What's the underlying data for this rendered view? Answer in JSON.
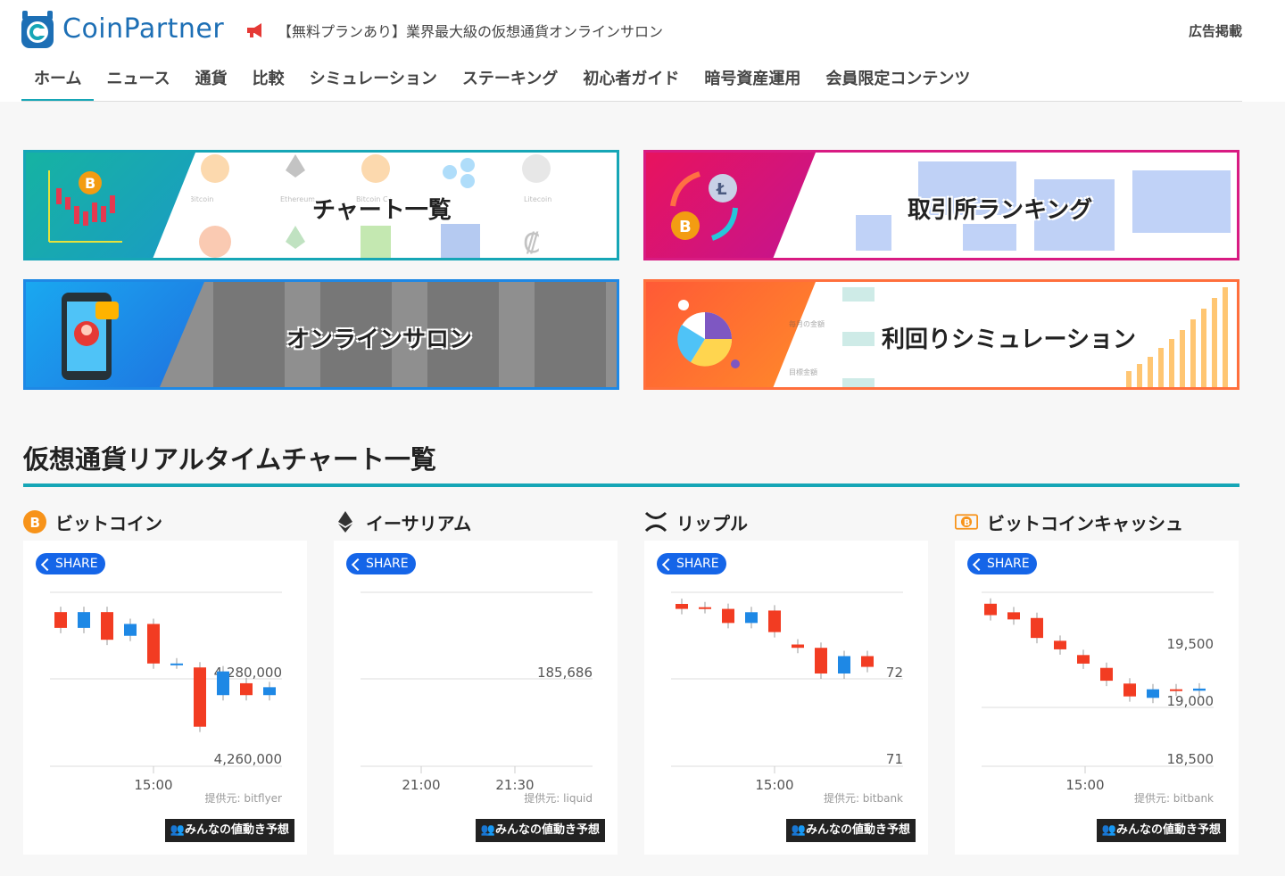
{
  "header": {
    "logo_text": "CoinPartner",
    "promo_text": "【無料プランあり】業界最大級の仮想通貨オンラインサロン",
    "ad_link": "広告掲載"
  },
  "nav": {
    "items": [
      {
        "label": "ホーム",
        "active": true
      },
      {
        "label": "ニュース"
      },
      {
        "label": "通貨"
      },
      {
        "label": "比較"
      },
      {
        "label": "シミュレーション"
      },
      {
        "label": "ステーキング"
      },
      {
        "label": "初心者ガイド"
      },
      {
        "label": "暗号資産運用"
      },
      {
        "label": "会員限定コンテンツ"
      }
    ]
  },
  "banners": [
    {
      "title": "チャート一覧",
      "accent": "#16a6b6"
    },
    {
      "title": "取引所ランキング",
      "accent": "#d81b82"
    },
    {
      "title": "オンラインサロン",
      "accent": "#1e88e5"
    },
    {
      "title": "利回りシミュレーション",
      "accent": "#ff6f3c"
    }
  ],
  "banner_decor": {
    "chart_coins": [
      "Bitcoin",
      "Ethereum",
      "Bitcoin Ca",
      "Litecoin"
    ],
    "sim_labels": [
      "毎月の金額",
      "目標金額"
    ]
  },
  "section": {
    "title": "仮想通貨リアルタイムチャート一覧"
  },
  "colors": {
    "up": "#f23c22",
    "down": "#1e88e5",
    "teal": "#16a6b6",
    "share": "#1565e8"
  },
  "coins": [
    {
      "name": "ビットコイン",
      "icon": "bitcoin-icon",
      "share_label": "SHARE",
      "provider": "提供元: bitflyer",
      "predict_label": "みんなの値動き予想",
      "chart_data": {
        "type": "candlestick",
        "y_ticks": [
          "4,280,000",
          "4,260,000"
        ],
        "x_ticks": [
          "15:00"
        ],
        "ylim": [
          4253000,
          4297000
        ],
        "candles": [
          {
            "o": 4292000,
            "c": 4288000
          },
          {
            "o": 4288000,
            "c": 4292000
          },
          {
            "o": 4292000,
            "c": 4285000
          },
          {
            "o": 4286000,
            "c": 4289000
          },
          {
            "o": 4289000,
            "c": 4279000
          },
          {
            "o": 4279000,
            "c": 4279000
          },
          {
            "o": 4278000,
            "c": 4263000
          },
          {
            "o": 4271000,
            "c": 4277000
          },
          {
            "o": 4274000,
            "c": 4271000
          },
          {
            "o": 4271000,
            "c": 4273000
          }
        ]
      }
    },
    {
      "name": "イーサリアム",
      "icon": "ethereum-icon",
      "share_label": "SHARE",
      "provider": "提供元: liquid",
      "predict_label": "みんなの値動き予想",
      "chart_data": {
        "type": "candlestick",
        "y_ticks": [
          "185,686"
        ],
        "x_ticks": [
          "21:00",
          "21:30"
        ],
        "candles": []
      }
    },
    {
      "name": "リップル",
      "icon": "ripple-icon",
      "share_label": "SHARE",
      "provider": "提供元: bitbank",
      "predict_label": "みんなの値動き予想",
      "chart_data": {
        "type": "candlestick",
        "y_ticks": [
          "72",
          "71"
        ],
        "x_ticks": [
          "15:00"
        ],
        "ylim": [
          70.9,
          73.0
        ],
        "candles": [
          {
            "o": 72.86,
            "c": 72.8
          },
          {
            "o": 72.82,
            "c": 72.81
          },
          {
            "o": 72.8,
            "c": 72.63
          },
          {
            "o": 72.63,
            "c": 72.76
          },
          {
            "o": 72.78,
            "c": 72.52
          },
          {
            "o": 72.37,
            "c": 72.33
          },
          {
            "o": 72.33,
            "c": 72.02
          },
          {
            "o": 72.02,
            "c": 72.23
          },
          {
            "o": 72.23,
            "c": 72.1
          }
        ]
      }
    },
    {
      "name": "ビットコインキャッシュ",
      "icon": "bitcoin-cash-icon",
      "share_label": "SHARE",
      "provider": "提供元: bitbank",
      "predict_label": "みんなの値動き予想",
      "chart_data": {
        "type": "candlestick",
        "y_ticks": [
          "19,500",
          "19,000",
          "18,500"
        ],
        "x_ticks": [
          "15:00"
        ],
        "ylim": [
          18500,
          19720
        ],
        "candles": [
          {
            "o": 19640,
            "c": 19560
          },
          {
            "o": 19580,
            "c": 19530
          },
          {
            "o": 19540,
            "c": 19400
          },
          {
            "o": 19380,
            "c": 19320
          },
          {
            "o": 19280,
            "c": 19220
          },
          {
            "o": 19190,
            "c": 19100
          },
          {
            "o": 19080,
            "c": 18990
          },
          {
            "o": 18980,
            "c": 19040
          },
          {
            "o": 19040,
            "c": 19030
          },
          {
            "o": 19030,
            "c": 19045
          }
        ]
      }
    }
  ]
}
